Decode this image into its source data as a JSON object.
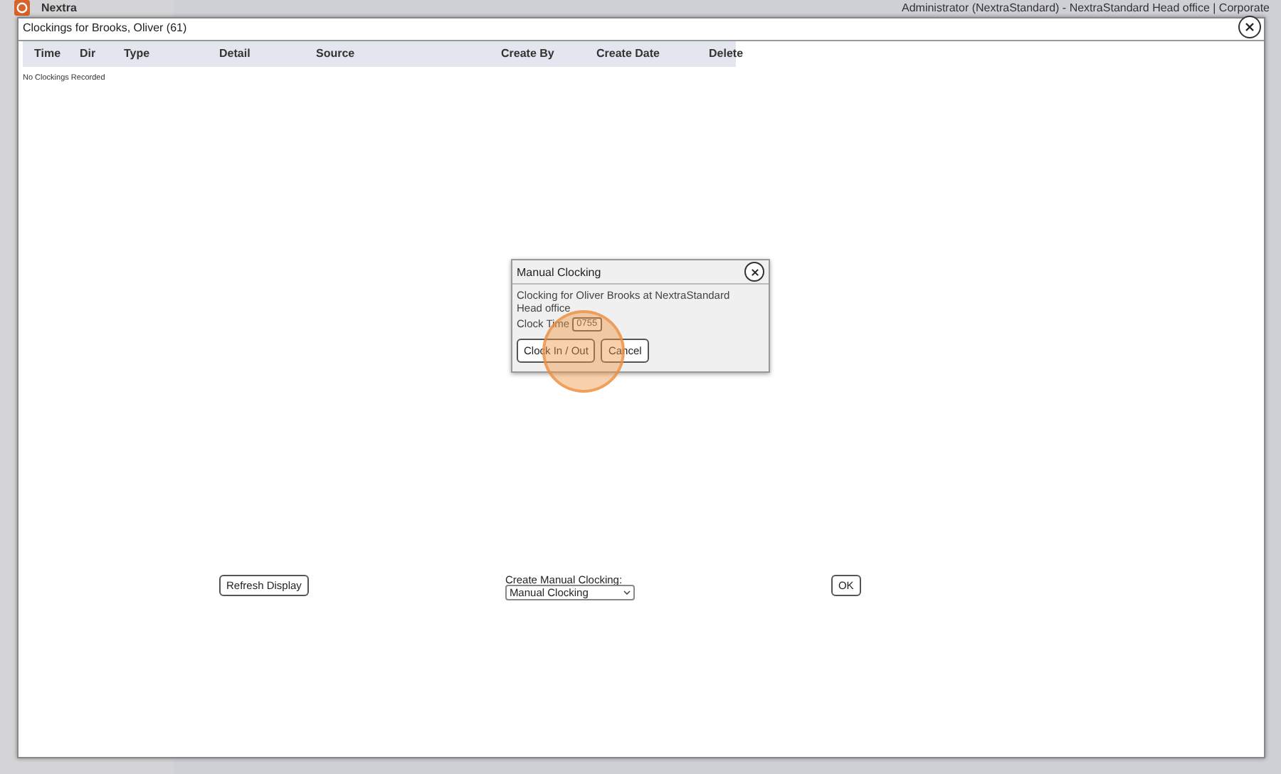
{
  "background": {
    "app_name": "Nextra",
    "header_text": "Administrator (NextraStandard) - NextraStandard Head office | Corporate"
  },
  "window": {
    "title": "Clockings for Brooks, Oliver (61)",
    "table": {
      "columns": [
        "Time",
        "Dir",
        "Type",
        "Detail",
        "Source",
        "Create By",
        "Create Date",
        "Delete"
      ],
      "empty_text": "No Clockings Recorded"
    },
    "refresh_button": "Refresh Display",
    "create_label": "Create Manual Clocking:",
    "create_select": "Manual Clocking",
    "ok_button": "OK"
  },
  "dialog": {
    "title": "Manual Clocking",
    "message": "Clocking for Oliver Brooks at NextraStandard Head office",
    "time_label": "Clock Time",
    "time_value": "0755",
    "buttons": [
      {
        "label": "Clock In / Out",
        "clicked": true
      },
      {
        "label": "Cancel",
        "clicked": false
      }
    ]
  }
}
